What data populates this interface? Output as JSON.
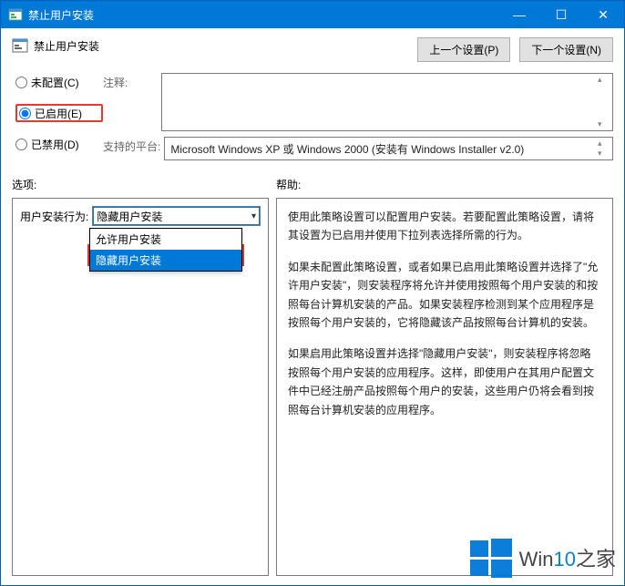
{
  "window": {
    "title": "禁止用户安装",
    "minimize": "—",
    "maximize": "☐",
    "close": "✕"
  },
  "header": {
    "title": "禁止用户安装",
    "prev": "上一个设置(P)",
    "next": "下一个设置(N)"
  },
  "radios": {
    "not_configured": "未配置(C)",
    "enabled": "已启用(E)",
    "disabled": "已禁用(D)",
    "selected": "enabled"
  },
  "labels": {
    "comment": "注释:",
    "supported": "支持的平台:",
    "options": "选项:",
    "help": "帮助:"
  },
  "supported_text": "Microsoft Windows XP 或 Windows 2000 (安装有 Windows Installer v2.0)",
  "options": {
    "behavior_label": "用户安装行为:",
    "selected_value": "隐藏用户安装",
    "items": [
      "允许用户安装",
      "隐藏用户安装"
    ]
  },
  "help_text": {
    "p1": "使用此策略设置可以配置用户安装。若要配置此策略设置，请将其设置为已启用并使用下拉列表选择所需的行为。",
    "p2": "如果未配置此策略设置，或者如果已启用此策略设置并选择了\"允许用户安装\"，则安装程序将允许并使用按照每个用户安装的和按照每台计算机安装的产品。如果安装程序检测到某个应用程序是按照每个用户安装的，它将隐藏该产品按照每台计算机的安装。",
    "p3": "如果启用此策略设置并选择\"隐藏用户安装\"，则安装程序将忽略按照每个用户安装的应用程序。这样，即使用户在其用户配置文件中已经注册产品按照每个用户的安装，这些用户仍将会看到按照每台计算机安装的应用程序。"
  },
  "watermark": {
    "text_prefix": "Win",
    "text_accent": "10",
    "text_suffix": "之家"
  }
}
